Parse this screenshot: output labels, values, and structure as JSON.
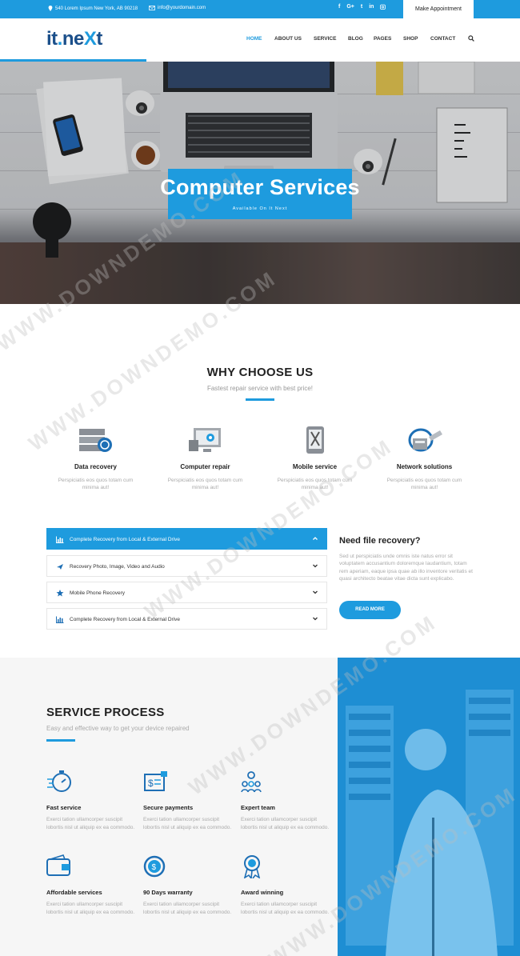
{
  "topbar": {
    "address": "540 Lorem Ipsum New York, AB 90218",
    "email": "info@yourdomain.com",
    "social": [
      "f",
      "G+",
      "t",
      "in",
      "ig"
    ],
    "appointment_label": "Make Appointment"
  },
  "header": {
    "logo_left": "it",
    "logo_dot": ".",
    "logo_ne": "ne",
    "logo_x": "X",
    "logo_t": "t",
    "nav": [
      "HOME",
      "ABOUT US",
      "SERVICE",
      "BLOG",
      "PAGES",
      "SHOP",
      "CONTACT"
    ],
    "active_nav": "HOME"
  },
  "hero": {
    "title": "Computer Services",
    "subtitle": "Available On It Next"
  },
  "why": {
    "title": "WHY CHOOSE US",
    "subtitle": "Fastest repair service with best price!",
    "features": [
      {
        "title": "Data recovery",
        "text": "Perspiciatis eos quos totam cum minima aut!",
        "icon": "server-icon"
      },
      {
        "title": "Computer repair",
        "text": "Perspiciatis eos quos totam cum minima aut!",
        "icon": "monitor-gear-icon"
      },
      {
        "title": "Mobile service",
        "text": "Perspiciatis eos quos totam cum minima aut!",
        "icon": "phone-tools-icon"
      },
      {
        "title": "Network solutions",
        "text": "Perspiciatis eos quos totam cum minima aut!",
        "icon": "network-cable-icon"
      }
    ]
  },
  "accordion": [
    {
      "label": "Complete Recovery from Local & External Drive",
      "icon": "chart-icon",
      "active": true
    },
    {
      "label": "Recovery Photo, Image, Video and Audio",
      "icon": "plane-icon",
      "active": false
    },
    {
      "label": "Mobile Phone Recovery",
      "icon": "star-icon",
      "active": false
    },
    {
      "label": "Complete Recovery from Local & External Drive",
      "icon": "chart-icon",
      "active": false
    }
  ],
  "recovery": {
    "title": "Need file recovery?",
    "text": "Sed ut perspiciatis unde omnis iste natus error sit voluptatem accusantium doloremque laudantium, totam rem aperiam, eaque ipsa quae ab illo inventore veritatis et quasi architecto beatae vitae dicta sunt explicabo.",
    "button": "READ MORE"
  },
  "process": {
    "title": "SERVICE PROCESS",
    "subtitle": "Easy and effective way to get your device repaired",
    "items": [
      {
        "title": "Fast service",
        "text": "Exerci tation ullamcorper suscipit lobortis nisl ut aliquip ex ea commodo.",
        "icon": "stopwatch-icon"
      },
      {
        "title": "Secure payments",
        "text": "Exerci tation ullamcorper suscipit lobortis nisl ut aliquip ex ea commodo.",
        "icon": "secure-payment-icon"
      },
      {
        "title": "Expert team",
        "text": "Exerci tation ullamcorper suscipit lobortis nisl ut aliquip ex ea commodo.",
        "icon": "team-icon"
      },
      {
        "title": "Affordable services",
        "text": "Exerci tation ullamcorper suscipit lobortis nisl ut aliquip ex ea commodo.",
        "icon": "wallet-icon"
      },
      {
        "title": "90 Days warranty",
        "text": "Exerci tation ullamcorper suscipit lobortis nisl ut aliquip ex ea commodo.",
        "icon": "warranty-icon"
      },
      {
        "title": "Award winning",
        "text": "Exerci tation ullamcorper suscipit lobortis nisl ut aliquip ex ea commodo.",
        "icon": "award-icon"
      }
    ]
  },
  "watermark": "WWW.DOWNDEMO.COM",
  "colors": {
    "accent": "#1e9bde",
    "dark_text": "#222222",
    "muted_text": "#aaaaaa",
    "section_bg": "#f6f6f6"
  }
}
